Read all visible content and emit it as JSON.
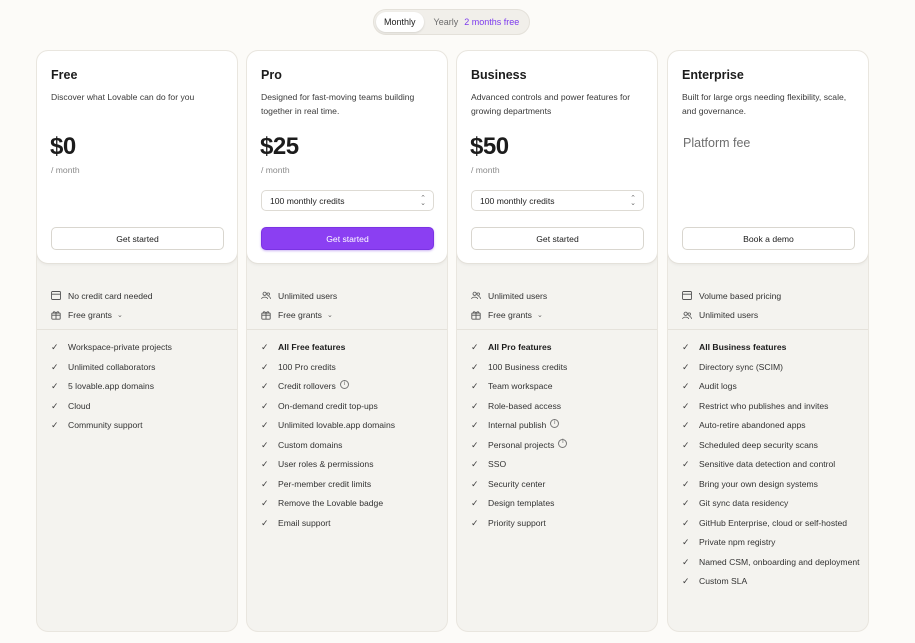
{
  "billing": {
    "monthly": "Monthly",
    "yearly": "Yearly",
    "discount": "2 months free"
  },
  "plans": [
    {
      "name": "Free",
      "description": "Discover what Lovable can do for you",
      "price": "$0",
      "period": "/ month",
      "cta": "Get started",
      "top": [
        {
          "icon": "card-icon",
          "label": "No credit card needed"
        },
        {
          "icon": "gift-icon",
          "label": "Free grants"
        }
      ],
      "features": [
        {
          "label": "Workspace-private projects"
        },
        {
          "label": "Unlimited collaborators"
        },
        {
          "label": "5 lovable.app domains"
        },
        {
          "label": "Cloud"
        },
        {
          "label": "Community support"
        }
      ]
    },
    {
      "name": "Pro",
      "description": "Designed for fast-moving teams building together in real time.",
      "price": "$25",
      "period": "/ month",
      "credits": "100 monthly credits",
      "cta": "Get started",
      "top": [
        {
          "icon": "users-icon",
          "label": "Unlimited users"
        },
        {
          "icon": "gift-icon",
          "label": "Free grants"
        }
      ],
      "features": [
        {
          "label": "All Free features",
          "bold": true
        },
        {
          "label": "100 Pro credits"
        },
        {
          "label": "Credit rollovers",
          "info": true
        },
        {
          "label": "On-demand credit top-ups"
        },
        {
          "label": "Unlimited lovable.app domains"
        },
        {
          "label": "Custom domains"
        },
        {
          "label": "User roles & permissions"
        },
        {
          "label": "Per-member credit limits"
        },
        {
          "label": "Remove the Lovable badge"
        },
        {
          "label": "Email support"
        }
      ]
    },
    {
      "name": "Business",
      "description": "Advanced controls and power features for growing departments",
      "price": "$50",
      "period": "/ month",
      "credits": "100 monthly credits",
      "cta": "Get started",
      "top": [
        {
          "icon": "users-icon",
          "label": "Unlimited users"
        },
        {
          "icon": "gift-icon",
          "label": "Free grants"
        }
      ],
      "features": [
        {
          "label": "All Pro features",
          "bold": true
        },
        {
          "label": "100 Business credits"
        },
        {
          "label": "Team workspace"
        },
        {
          "label": "Role-based access"
        },
        {
          "label": "Internal publish",
          "info": true
        },
        {
          "label": "Personal projects",
          "info": true
        },
        {
          "label": "SSO"
        },
        {
          "label": "Security center"
        },
        {
          "label": "Design templates"
        },
        {
          "label": "Priority support"
        }
      ]
    },
    {
      "name": "Enterprise",
      "description": "Built for large orgs needing flexibility, scale, and governance.",
      "price_text": "Platform fee",
      "cta": "Book a demo",
      "top": [
        {
          "icon": "card-icon",
          "label": "Volume based pricing"
        },
        {
          "icon": "users-icon",
          "label": "Unlimited users"
        }
      ],
      "features": [
        {
          "label": "All Business features",
          "bold": true
        },
        {
          "label": "Directory sync (SCIM)"
        },
        {
          "label": "Audit logs"
        },
        {
          "label": "Restrict who publishes and invites"
        },
        {
          "label": "Auto-retire abandoned apps"
        },
        {
          "label": "Scheduled deep security scans"
        },
        {
          "label": "Sensitive data detection and control"
        },
        {
          "label": "Bring your own design systems"
        },
        {
          "label": "Git sync data residency"
        },
        {
          "label": "GitHub Enterprise, cloud or self-hosted"
        },
        {
          "label": "Private npm registry"
        },
        {
          "label": "Named CSM, onboarding and deployment"
        },
        {
          "label": "Custom SLA"
        }
      ]
    }
  ],
  "colors": {
    "primary": "#8b3ff2",
    "discount": "#7c3aed",
    "background": "#fcfbf8"
  }
}
